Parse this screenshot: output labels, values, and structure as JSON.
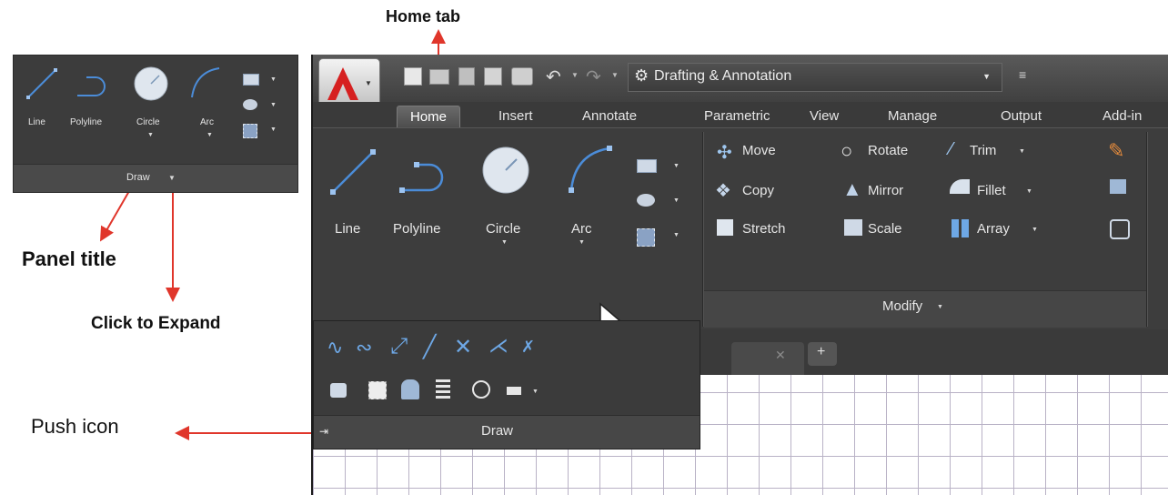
{
  "annotations": {
    "home_tab": "Home tab",
    "panel_title": "Panel title",
    "click_to_expand": "Click to Expand",
    "push_icon": "Push icon"
  },
  "mini_panel": {
    "tools": [
      "Line",
      "Polyline",
      "Circle",
      "Arc"
    ],
    "title": "Draw"
  },
  "quick_access": {
    "workspace": "Drafting & Annotation"
  },
  "ribbon": {
    "tabs": [
      "Home",
      "Insert",
      "Annotate",
      "Parametric",
      "View",
      "Manage",
      "Output",
      "Add-in"
    ],
    "draw_tools": [
      "Line",
      "Polyline",
      "Circle",
      "Arc"
    ],
    "modify_tools": [
      "Move",
      "Rotate",
      "Trim",
      "Copy",
      "Mirror",
      "Fillet",
      "Stretch",
      "Scale",
      "Array"
    ],
    "modify_title": "Modify"
  },
  "expanded_panel": {
    "title": "Draw"
  },
  "colors": {
    "arrow": "#e0362b",
    "ribbon_bg": "#3d3d3d",
    "grid_line": "#b9b2c6"
  }
}
